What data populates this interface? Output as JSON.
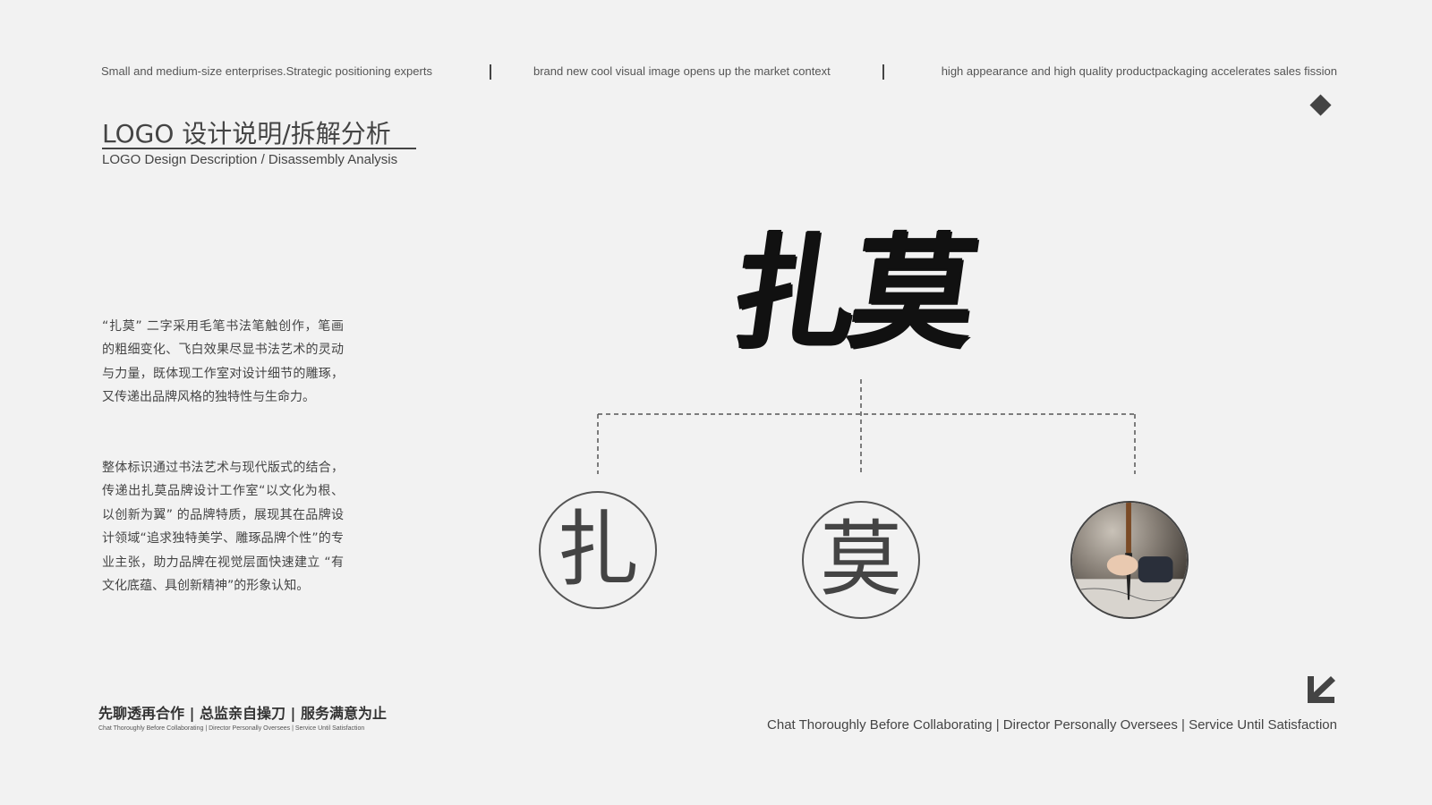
{
  "header": {
    "items": [
      "Small and medium-size enterprises.Strategic positioning experts",
      "brand new cool visual image opens up the market context",
      "high appearance and high quality productpackaging accelerates sales fission"
    ]
  },
  "title": {
    "cn": "LOGO 设计说明/拆解分析",
    "en": "LOGO Design Description / Disassembly Analysis"
  },
  "body": {
    "p1": "“扎莫” 二字采用毛笔书法笔触创作，笔画的粗细变化、飞白效果尽显书法艺术的灵动与力量，既体现工作室对设计细节的雕琢，又传递出品牌风格的独特性与生命力。",
    "p2": "整体标识通过书法艺术与现代版式的结合，传递出扎莫品牌设计工作室“以文化为根、以创新为翼” 的品牌特质，展现其在品牌设计领域“追求独特美学、雕琢品牌个性”的专业主张，助力品牌在视觉层面快速建立 “有文化底蕴、具创新精神”的形象认知。"
  },
  "logo": {
    "mark": "扎莫",
    "char1": "扎",
    "char2": "莫",
    "photo_icon": "calligraphy-brush-photo"
  },
  "footer": {
    "slogan_cn": "先聊透再合作 | 总监亲自操刀 | 服务满意为止",
    "slogan_en": "Chat Thoroughly Before Collaborating | Director Personally Oversees | Service Until Satisfaction",
    "arrow_icon": "arrow-down-left-icon"
  },
  "colors": {
    "background": "#f2f2f2",
    "text": "#444444",
    "ink": "#111111"
  }
}
